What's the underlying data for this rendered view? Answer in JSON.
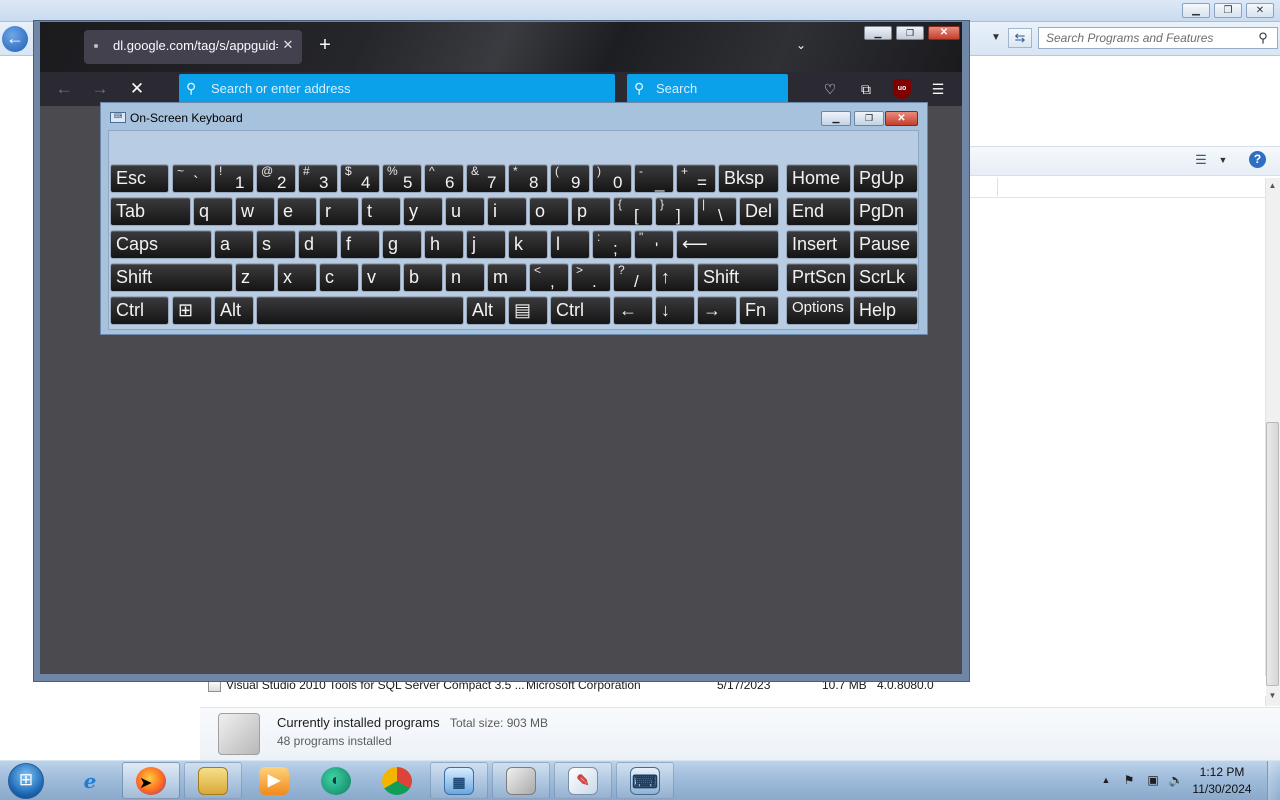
{
  "control_panel": {
    "search_placeholder": "Search Programs and Features",
    "row": {
      "name": "Visual Studio 2010 Tools for SQL Server Compact 3.5 ...",
      "publisher": "Microsoft Corporation",
      "installed_on": "5/17/2023",
      "size": "10.7 MB",
      "version": "4.0.8080.0"
    },
    "details": {
      "title": "Currently installed programs",
      "total_size": "Total size: 903 MB",
      "count": "48 programs installed"
    }
  },
  "firefox": {
    "tab_title": "dl.google.com/tag/s/appguid=",
    "address_placeholder": "Search or enter address",
    "search_placeholder": "Search",
    "ublock_label": "uo"
  },
  "osk": {
    "title": "On-Screen Keyboard",
    "rows": [
      [
        {
          "label": "Esc"
        },
        {
          "top": "~",
          "main": "`"
        },
        {
          "top": "!",
          "main": "1"
        },
        {
          "top": "@",
          "main": "2"
        },
        {
          "top": "#",
          "main": "3"
        },
        {
          "top": "$",
          "main": "4"
        },
        {
          "top": "%",
          "main": "5"
        },
        {
          "top": "^",
          "main": "6"
        },
        {
          "top": "&",
          "main": "7"
        },
        {
          "top": "*",
          "main": "8"
        },
        {
          "top": "(",
          "main": "9"
        },
        {
          "top": ")",
          "main": "0"
        },
        {
          "top": "-",
          "main": "_"
        },
        {
          "top": "+",
          "main": "="
        },
        {
          "label": "Bksp"
        },
        {
          "label": "Home"
        },
        {
          "label": "PgUp"
        }
      ],
      [
        {
          "label": "Tab"
        },
        {
          "label": "q"
        },
        {
          "label": "w"
        },
        {
          "label": "e"
        },
        {
          "label": "r"
        },
        {
          "label": "t"
        },
        {
          "label": "y"
        },
        {
          "label": "u"
        },
        {
          "label": "i"
        },
        {
          "label": "o"
        },
        {
          "label": "p"
        },
        {
          "top": "{",
          "main": "["
        },
        {
          "top": "}",
          "main": "]"
        },
        {
          "top": "|",
          "main": "\\"
        },
        {
          "label": "Del"
        },
        {
          "label": "End"
        },
        {
          "label": "PgDn"
        }
      ],
      [
        {
          "label": "Caps"
        },
        {
          "label": "a"
        },
        {
          "label": "s"
        },
        {
          "label": "d"
        },
        {
          "label": "f"
        },
        {
          "label": "g"
        },
        {
          "label": "h"
        },
        {
          "label": "j"
        },
        {
          "label": "k"
        },
        {
          "label": "l"
        },
        {
          "top": ":",
          "main": ";"
        },
        {
          "top": "\"",
          "main": "'"
        },
        {
          "label": "⟵"
        },
        {
          "label": "Insert"
        },
        {
          "label": "Pause"
        }
      ],
      [
        {
          "label": "Shift"
        },
        {
          "label": "z"
        },
        {
          "label": "x"
        },
        {
          "label": "c"
        },
        {
          "label": "v"
        },
        {
          "label": "b"
        },
        {
          "label": "n"
        },
        {
          "label": "m"
        },
        {
          "top": "<",
          "main": ","
        },
        {
          "top": ">",
          "main": "."
        },
        {
          "top": "?",
          "main": "/"
        },
        {
          "label": "↑"
        },
        {
          "label": "Shift"
        },
        {
          "label": "PrtScn"
        },
        {
          "label": "ScrLk"
        }
      ],
      [
        {
          "label": "Ctrl"
        },
        {
          "label": "⊞"
        },
        {
          "label": "Alt"
        },
        {
          "label": ""
        },
        {
          "label": "Alt"
        },
        {
          "label": "▤"
        },
        {
          "label": "Ctrl"
        },
        {
          "label": "←"
        },
        {
          "label": "↓"
        },
        {
          "label": "→"
        },
        {
          "label": "Fn"
        },
        {
          "label": "Options"
        },
        {
          "label": "Help"
        }
      ]
    ]
  },
  "taskbar": {
    "time": "1:12 PM",
    "date": "11/30/2024"
  }
}
